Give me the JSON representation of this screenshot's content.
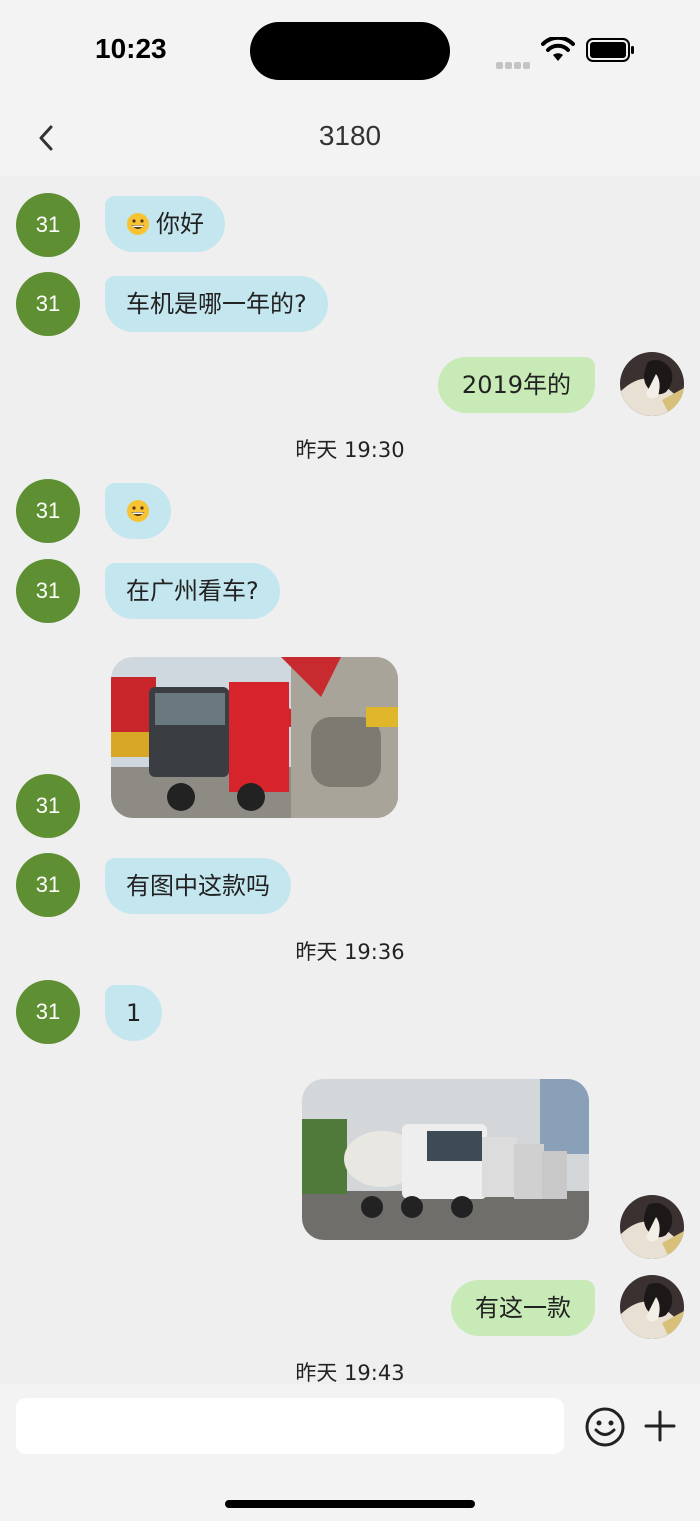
{
  "status_bar": {
    "time": "10:23"
  },
  "header": {
    "title": "3180"
  },
  "other_user": {
    "avatar_text": "31"
  },
  "messages": {
    "m1": "你好",
    "m2": "车机是哪一年的?",
    "m3": "2019年的",
    "ts1": "昨天 19:30",
    "m5": "在广州看车?",
    "m7": "有图中这款吗",
    "ts2": "昨天 19:36",
    "m8": "1",
    "m10": "有这一款",
    "ts3": "昨天 19:43"
  },
  "composer": {
    "placeholder": ""
  },
  "colors": {
    "avatar": "#5f8f33",
    "bubble_received": "#c4e6ef",
    "bubble_sent": "#c7eab6",
    "background": "#efefef"
  }
}
